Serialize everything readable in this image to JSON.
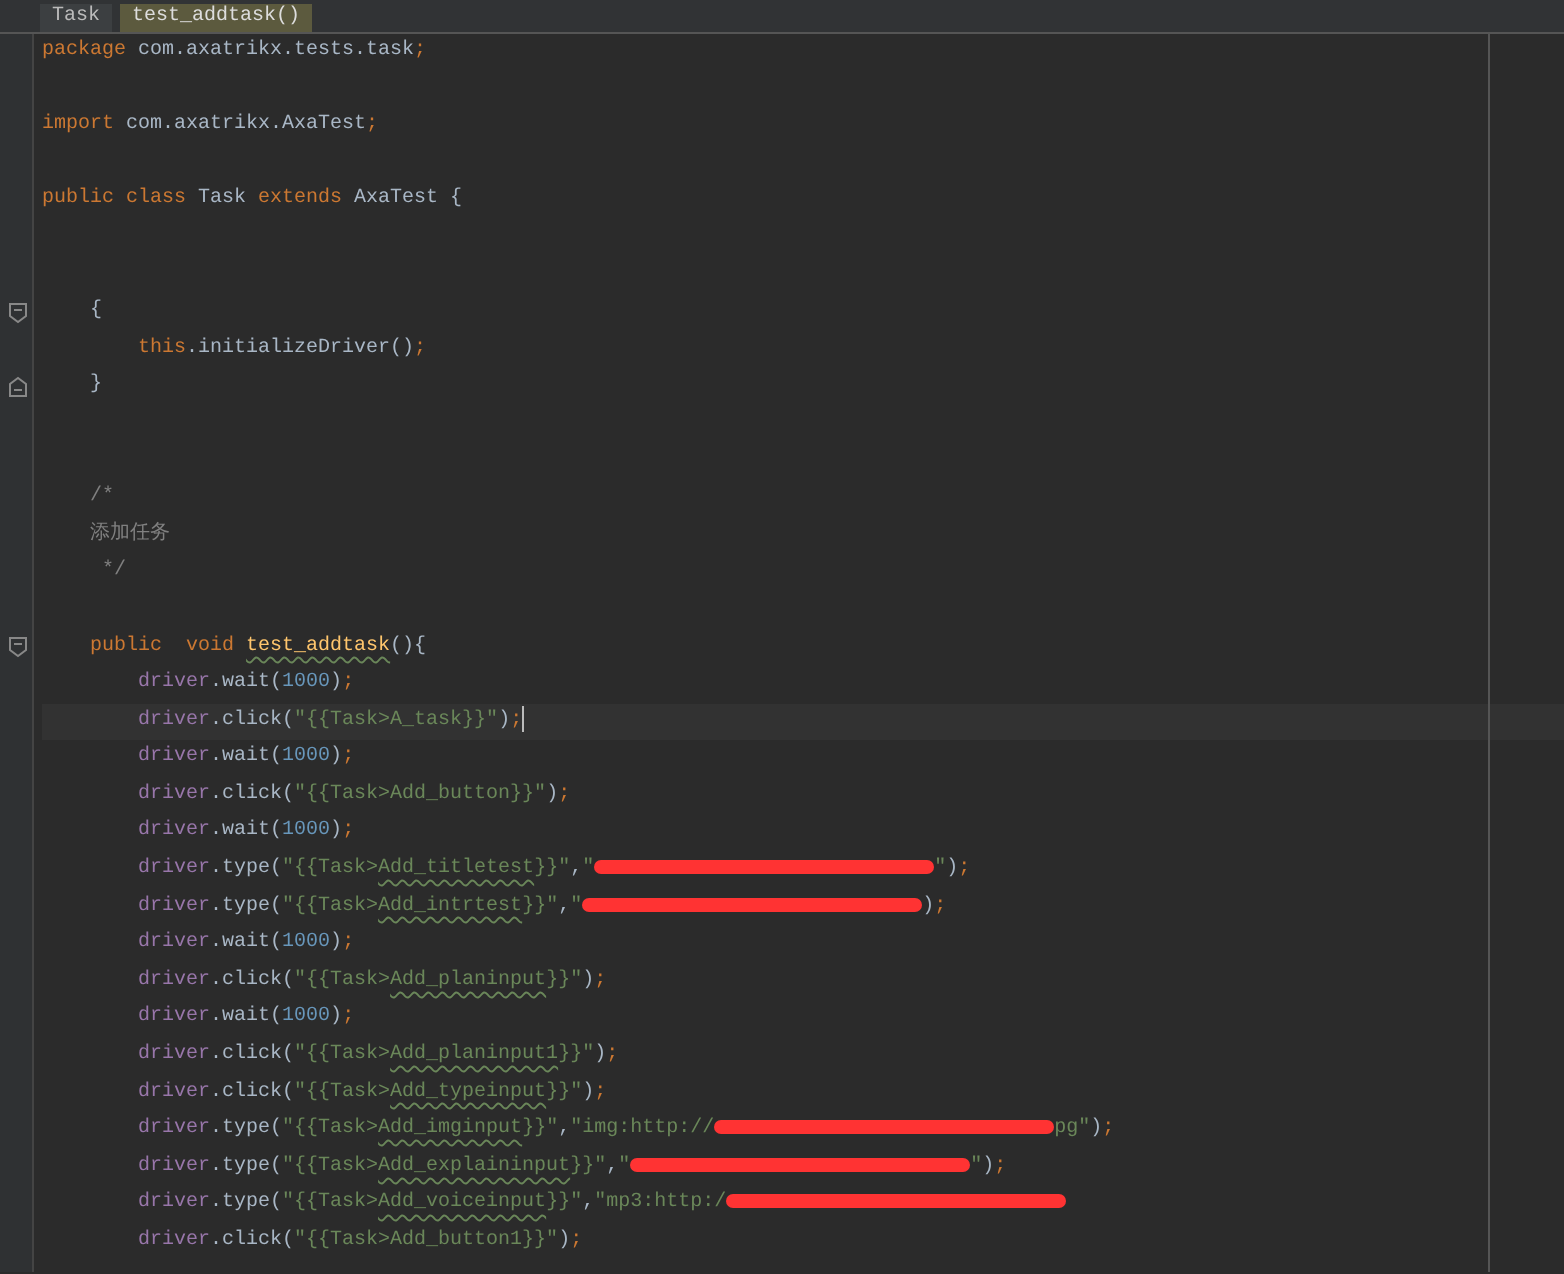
{
  "breadcrumbs": [
    {
      "label": "Task",
      "selected": false
    },
    {
      "label": "test_addtask()",
      "selected": true
    }
  ],
  "lines": [
    {
      "kind": "code",
      "tokens": [
        {
          "kind": "kw",
          "text": "package"
        },
        {
          "kind": "plain",
          "text": " com.axatrikx.tests.task"
        },
        {
          "kind": "semi",
          "text": ";"
        }
      ]
    },
    {
      "kind": "blank"
    },
    {
      "kind": "code",
      "tokens": [
        {
          "kind": "kw",
          "text": "import"
        },
        {
          "kind": "plain",
          "text": " com.axatrikx.AxaTest"
        },
        {
          "kind": "semi",
          "text": ";"
        }
      ]
    },
    {
      "kind": "blank"
    },
    {
      "kind": "code",
      "tokens": [
        {
          "kind": "kw",
          "text": "public class"
        },
        {
          "kind": "plain",
          "text": " Task "
        },
        {
          "kind": "kw",
          "text": "extends"
        },
        {
          "kind": "plain",
          "text": " AxaTest {"
        }
      ]
    },
    {
      "kind": "blank"
    },
    {
      "kind": "blank"
    },
    {
      "kind": "code",
      "fold_start": true,
      "tokens": [
        {
          "kind": "plain",
          "text": "    {"
        }
      ]
    },
    {
      "kind": "code",
      "tokens": [
        {
          "kind": "kw",
          "text": "        this"
        },
        {
          "kind": "plain",
          "text": ".initializeDriver()"
        },
        {
          "kind": "semi",
          "text": ";"
        }
      ]
    },
    {
      "kind": "code",
      "fold_end": true,
      "tokens": [
        {
          "kind": "plain",
          "text": "    }"
        }
      ]
    },
    {
      "kind": "blank"
    },
    {
      "kind": "blank"
    },
    {
      "kind": "code",
      "tokens": [
        {
          "kind": "comment",
          "text": "    /*"
        }
      ]
    },
    {
      "kind": "code",
      "tokens": [
        {
          "kind": "comment",
          "text": "    添加任务"
        }
      ]
    },
    {
      "kind": "code",
      "tokens": [
        {
          "kind": "comment",
          "text": "     */"
        }
      ]
    },
    {
      "kind": "blank"
    },
    {
      "kind": "code",
      "fold_start": true,
      "tokens": [
        {
          "kind": "kw",
          "text": "    public  void "
        },
        {
          "kind": "fn",
          "text": "test_addtask",
          "warning": true
        },
        {
          "kind": "plain",
          "text": "(){"
        }
      ]
    },
    {
      "kind": "code",
      "tokens": [
        {
          "kind": "field",
          "text": "        driver"
        },
        {
          "kind": "plain",
          "text": ".wait("
        },
        {
          "kind": "num",
          "text": "1000"
        },
        {
          "kind": "plain",
          "text": ")"
        },
        {
          "kind": "semi",
          "text": ";"
        }
      ]
    },
    {
      "kind": "code",
      "current": true,
      "tokens": [
        {
          "kind": "field",
          "text": "        driver"
        },
        {
          "kind": "plain",
          "text": ".click("
        },
        {
          "kind": "str",
          "text": "\"{{Task>A_task}}\""
        },
        {
          "kind": "plain",
          "text": ")"
        },
        {
          "kind": "semi",
          "text": ";"
        }
      ]
    },
    {
      "kind": "code",
      "tokens": [
        {
          "kind": "field",
          "text": "        driver"
        },
        {
          "kind": "plain",
          "text": ".wait("
        },
        {
          "kind": "num",
          "text": "1000"
        },
        {
          "kind": "plain",
          "text": ")"
        },
        {
          "kind": "semi",
          "text": ";"
        }
      ]
    },
    {
      "kind": "code",
      "tokens": [
        {
          "kind": "field",
          "text": "        driver"
        },
        {
          "kind": "plain",
          "text": ".click("
        },
        {
          "kind": "str",
          "text": "\"{{Task>Add_button}}\""
        },
        {
          "kind": "plain",
          "text": ")"
        },
        {
          "kind": "semi",
          "text": ";"
        }
      ]
    },
    {
      "kind": "code",
      "tokens": [
        {
          "kind": "field",
          "text": "        driver"
        },
        {
          "kind": "plain",
          "text": ".wait("
        },
        {
          "kind": "num",
          "text": "1000"
        },
        {
          "kind": "plain",
          "text": ")"
        },
        {
          "kind": "semi",
          "text": ";"
        }
      ]
    },
    {
      "kind": "code",
      "tokens": [
        {
          "kind": "field",
          "text": "        driver"
        },
        {
          "kind": "plain",
          "text": ".type("
        },
        {
          "kind": "str",
          "text": "\"{{Task>"
        },
        {
          "kind": "str",
          "text": "Add_titletest",
          "warning": true
        },
        {
          "kind": "str",
          "text": "}}\""
        },
        {
          "kind": "plain",
          "text": ","
        },
        {
          "kind": "str",
          "text": "\""
        },
        {
          "kind": "redacted"
        },
        {
          "kind": "str",
          "text": "\""
        },
        {
          "kind": "plain",
          "text": ")"
        },
        {
          "kind": "semi",
          "text": ";"
        }
      ]
    },
    {
      "kind": "code",
      "tokens": [
        {
          "kind": "field",
          "text": "        driver"
        },
        {
          "kind": "plain",
          "text": ".type("
        },
        {
          "kind": "str",
          "text": "\"{{Task>"
        },
        {
          "kind": "str",
          "text": "Add_intrtest",
          "warning": true
        },
        {
          "kind": "str",
          "text": "}}\""
        },
        {
          "kind": "plain",
          "text": ","
        },
        {
          "kind": "str",
          "text": "\""
        },
        {
          "kind": "redacted"
        },
        {
          "kind": "plain",
          "text": ")"
        },
        {
          "kind": "semi",
          "text": ";"
        }
      ]
    },
    {
      "kind": "code",
      "tokens": [
        {
          "kind": "field",
          "text": "        driver"
        },
        {
          "kind": "plain",
          "text": ".wait("
        },
        {
          "kind": "num",
          "text": "1000"
        },
        {
          "kind": "plain",
          "text": ")"
        },
        {
          "kind": "semi",
          "text": ";"
        }
      ]
    },
    {
      "kind": "code",
      "tokens": [
        {
          "kind": "field",
          "text": "        driver"
        },
        {
          "kind": "plain",
          "text": ".click("
        },
        {
          "kind": "str",
          "text": "\"{{Task>"
        },
        {
          "kind": "str",
          "text": "Add_planinput",
          "warning": true
        },
        {
          "kind": "str",
          "text": "}}\""
        },
        {
          "kind": "plain",
          "text": ")"
        },
        {
          "kind": "semi",
          "text": ";"
        }
      ]
    },
    {
      "kind": "code",
      "tokens": [
        {
          "kind": "field",
          "text": "        driver"
        },
        {
          "kind": "plain",
          "text": ".wait("
        },
        {
          "kind": "num",
          "text": "1000"
        },
        {
          "kind": "plain",
          "text": ")"
        },
        {
          "kind": "semi",
          "text": ";"
        }
      ]
    },
    {
      "kind": "code",
      "tokens": [
        {
          "kind": "field",
          "text": "        driver"
        },
        {
          "kind": "plain",
          "text": ".click("
        },
        {
          "kind": "str",
          "text": "\"{{Task>"
        },
        {
          "kind": "str",
          "text": "Add_planinput1",
          "warning": true
        },
        {
          "kind": "str",
          "text": "}}\""
        },
        {
          "kind": "plain",
          "text": ")"
        },
        {
          "kind": "semi",
          "text": ";"
        }
      ]
    },
    {
      "kind": "code",
      "tokens": [
        {
          "kind": "field",
          "text": "        driver"
        },
        {
          "kind": "plain",
          "text": ".click("
        },
        {
          "kind": "str",
          "text": "\"{{Task>"
        },
        {
          "kind": "str",
          "text": "Add_typeinput",
          "warning": true
        },
        {
          "kind": "str",
          "text": "}}\""
        },
        {
          "kind": "plain",
          "text": ")"
        },
        {
          "kind": "semi",
          "text": ";"
        }
      ]
    },
    {
      "kind": "code",
      "tokens": [
        {
          "kind": "field",
          "text": "        driver"
        },
        {
          "kind": "plain",
          "text": ".type("
        },
        {
          "kind": "str",
          "text": "\"{{Task>"
        },
        {
          "kind": "str",
          "text": "Add_imginput",
          "warning": true
        },
        {
          "kind": "str",
          "text": "}}\""
        },
        {
          "kind": "plain",
          "text": ","
        },
        {
          "kind": "str",
          "text": "\"img:http://"
        },
        {
          "kind": "redacted"
        },
        {
          "kind": "str",
          "text": "pg\""
        },
        {
          "kind": "plain",
          "text": ")"
        },
        {
          "kind": "semi",
          "text": ";"
        }
      ]
    },
    {
      "kind": "code",
      "tokens": [
        {
          "kind": "field",
          "text": "        driver"
        },
        {
          "kind": "plain",
          "text": ".type("
        },
        {
          "kind": "str",
          "text": "\"{{Task>"
        },
        {
          "kind": "str",
          "text": "Add_explaininput",
          "warning": true
        },
        {
          "kind": "str",
          "text": "}}\""
        },
        {
          "kind": "plain",
          "text": ","
        },
        {
          "kind": "str",
          "text": "\""
        },
        {
          "kind": "redacted"
        },
        {
          "kind": "str",
          "text": "\""
        },
        {
          "kind": "plain",
          "text": ")"
        },
        {
          "kind": "semi",
          "text": ";"
        }
      ]
    },
    {
      "kind": "code",
      "tokens": [
        {
          "kind": "field",
          "text": "        driver"
        },
        {
          "kind": "plain",
          "text": ".type("
        },
        {
          "kind": "str",
          "text": "\"{{Task>"
        },
        {
          "kind": "str",
          "text": "Add_voiceinput",
          "warning": true
        },
        {
          "kind": "str",
          "text": "}}\""
        },
        {
          "kind": "plain",
          "text": ","
        },
        {
          "kind": "str",
          "text": "\"mp3:http:/"
        },
        {
          "kind": "redacted"
        }
      ]
    },
    {
      "kind": "code",
      "tokens": [
        {
          "kind": "field",
          "text": "        driver"
        },
        {
          "kind": "plain",
          "text": ".click("
        },
        {
          "kind": "str",
          "text": "\"{{Task>Add_button1}}\""
        },
        {
          "kind": "plain",
          "text": ")"
        },
        {
          "kind": "semi",
          "text": ";"
        }
      ]
    }
  ]
}
